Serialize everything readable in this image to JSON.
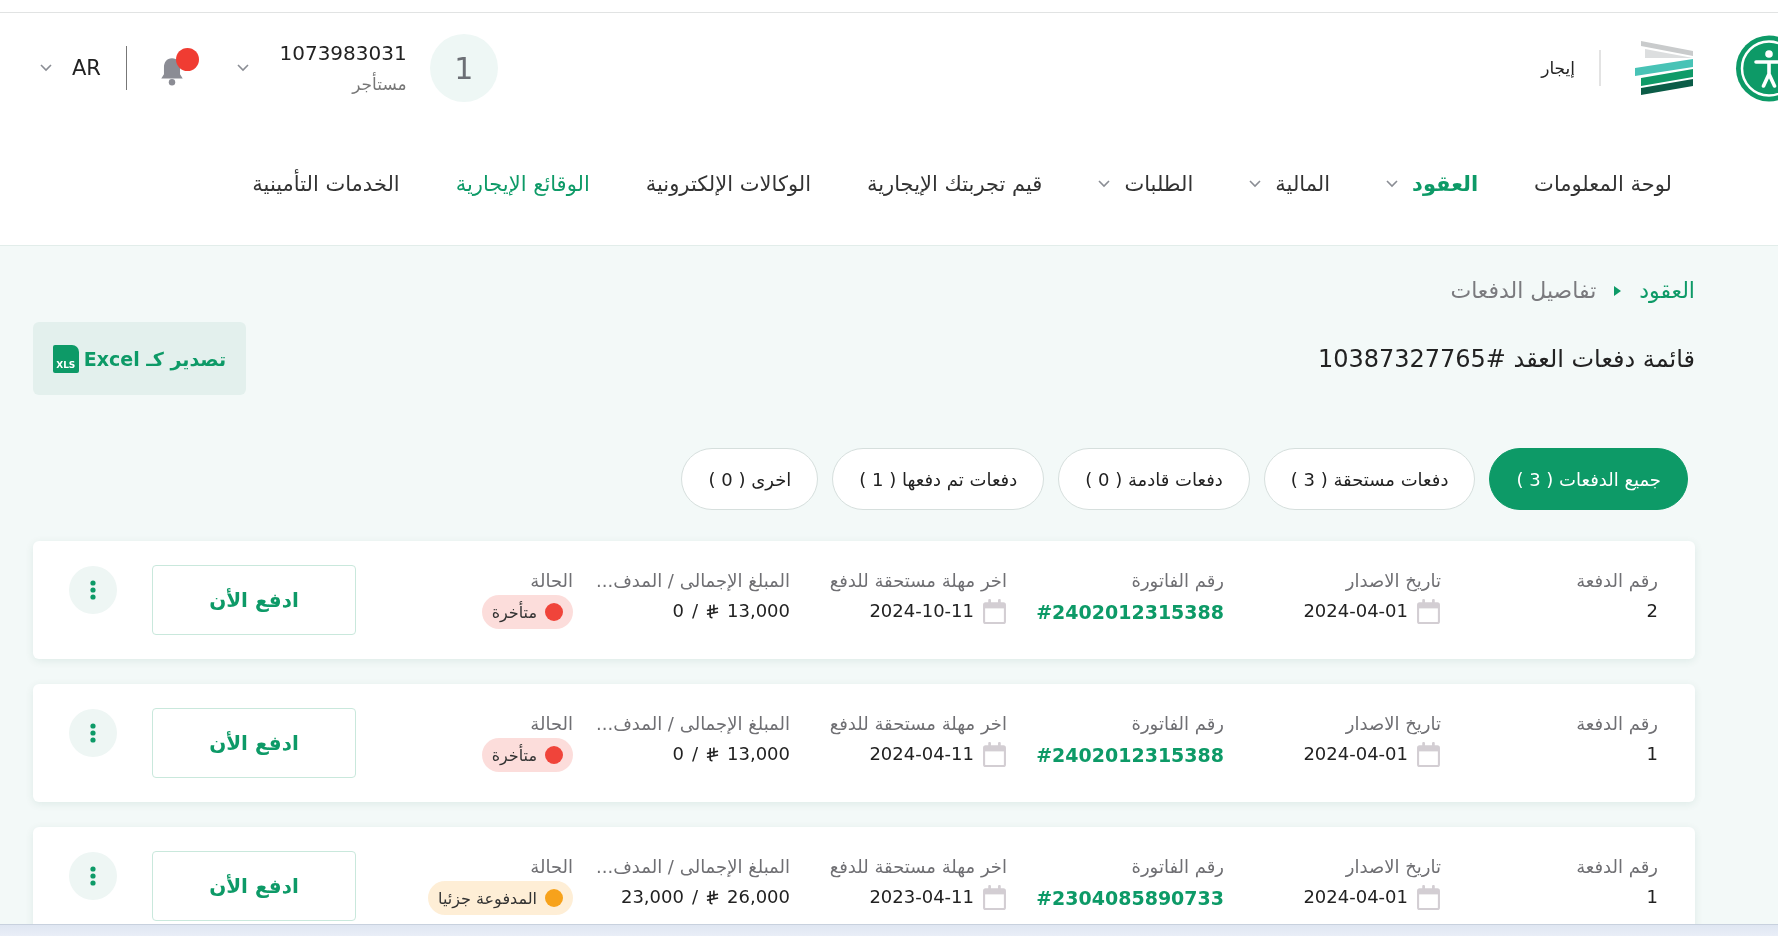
{
  "header": {
    "brand": "إيجار",
    "user": {
      "avatar": "1",
      "id": "1073983031",
      "role": "مستأجر"
    },
    "notifications": {
      "unread": true
    },
    "language": "AR"
  },
  "nav": [
    {
      "label": "لوحة المعلومات",
      "selected": false,
      "highlighted": false,
      "dropdown": false
    },
    {
      "label": "العقود",
      "selected": true,
      "highlighted": false,
      "dropdown": true
    },
    {
      "label": "المالية",
      "selected": false,
      "highlighted": false,
      "dropdown": true
    },
    {
      "label": "الطلبات",
      "selected": false,
      "highlighted": false,
      "dropdown": true
    },
    {
      "label": "قيم تجربتك الإيجارية",
      "selected": false,
      "highlighted": false,
      "dropdown": false
    },
    {
      "label": "الوكالات الإلكترونية",
      "selected": false,
      "highlighted": false,
      "dropdown": false
    },
    {
      "label": "الوقائع الإيجارية",
      "selected": false,
      "highlighted": true,
      "dropdown": false
    },
    {
      "label": "الخدمات التأمينية",
      "selected": false,
      "highlighted": false,
      "dropdown": false
    }
  ],
  "breadcrumb": [
    {
      "label": "العقود",
      "current": false
    },
    {
      "label": "تفاصيل الدفعات",
      "current": true
    }
  ],
  "page_title": "قائمة دفعات العقد #10387327765",
  "export_button": {
    "label": "تصدير كـ Excel",
    "icon_text": "XLS"
  },
  "filter_tabs": [
    {
      "label": "جميع الدفعات ( 3 )",
      "selected": true
    },
    {
      "label": "دفعات مستحقة ( 3 )",
      "selected": false
    },
    {
      "label": "دفعات قادمة ( 0 )",
      "selected": false
    },
    {
      "label": "دفعات تم دفعها ( 1 )",
      "selected": false
    },
    {
      "label": "اخرى ( 0 )",
      "selected": false
    }
  ],
  "payments": [
    {
      "fields": [
        {
          "label": "رقم الدفعة",
          "kind": "plain",
          "value": "2"
        },
        {
          "label": "تاريخ الاصدار",
          "kind": "date",
          "value": "2024-04-01"
        },
        {
          "label": "رقم الفاتورة",
          "kind": "invoice",
          "value": "#2402012315388"
        },
        {
          "label": "اخر مهلة مستحقة للدفع",
          "kind": "date",
          "value": "2024-10-11"
        },
        {
          "label": "المبلغ الإجمالى / المدف...",
          "kind": "amount",
          "total": "13,000",
          "separator": "/",
          "paid": "0"
        },
        {
          "label": "الحالة",
          "kind": "status",
          "value": "متأخرة",
          "color": "#f0443a"
        }
      ],
      "pay_button": "ادفع الأن"
    },
    {
      "fields": [
        {
          "label": "رقم الدفعة",
          "kind": "plain",
          "value": "1"
        },
        {
          "label": "تاريخ الاصدار",
          "kind": "date",
          "value": "2024-04-01"
        },
        {
          "label": "رقم الفاتورة",
          "kind": "invoice",
          "value": "#2402012315388"
        },
        {
          "label": "اخر مهلة مستحقة للدفع",
          "kind": "date",
          "value": "2024-04-11"
        },
        {
          "label": "المبلغ الإجمالى / المدف...",
          "kind": "amount",
          "total": "13,000",
          "separator": "/",
          "paid": "0"
        },
        {
          "label": "الحالة",
          "kind": "status",
          "value": "متأخرة",
          "color": "#f0443a"
        }
      ],
      "pay_button": "ادفع الأن"
    },
    {
      "fields": [
        {
          "label": "رقم الدفعة",
          "kind": "plain",
          "value": "1"
        },
        {
          "label": "تاريخ الاصدار",
          "kind": "date",
          "value": "2024-04-01"
        },
        {
          "label": "رقم الفاتورة",
          "kind": "invoice",
          "value": "#2304085890733"
        },
        {
          "label": "اخر مهلة مستحقة للدفع",
          "kind": "date",
          "value": "2023-04-11"
        },
        {
          "label": "المبلغ الإجمالى / المدف...",
          "kind": "amount",
          "total": "26,000",
          "separator": "/",
          "paid": "23,000"
        },
        {
          "label": "الحالة",
          "kind": "status",
          "value": "المدفوعة جزئيا",
          "color": "#f7a21b"
        }
      ],
      "pay_button": "ادفع الأن"
    }
  ]
}
